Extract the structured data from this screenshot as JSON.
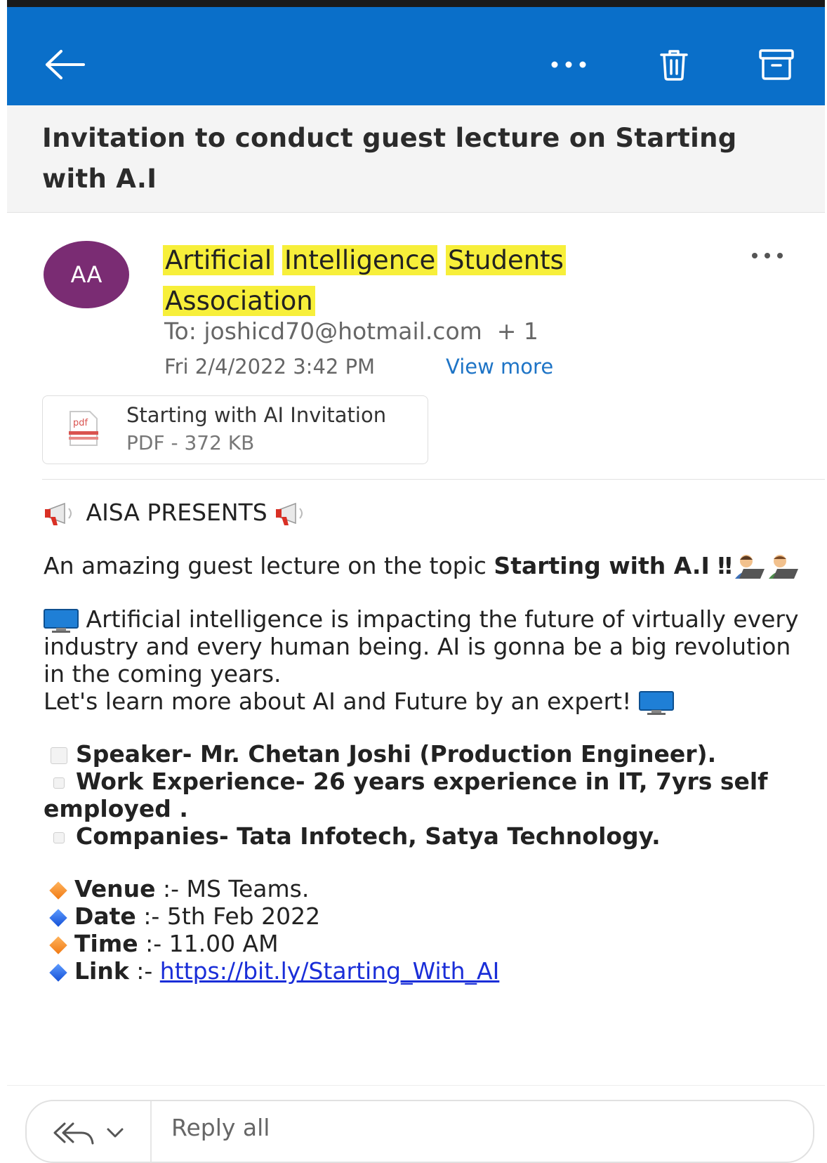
{
  "toolbar": {
    "back_icon": "arrow-left-icon",
    "more_icon": "more-horizontal-icon",
    "delete_icon": "trash-icon",
    "archive_icon": "archive-icon",
    "bar_color": "#0a6fc9"
  },
  "email": {
    "subject": "Invitation to conduct guest lecture on Starting with A.I",
    "avatar_initials": "AA",
    "avatar_color": "#7a2c73",
    "sender_words": [
      "Artificial",
      "Intelligence",
      "Students",
      "Association"
    ],
    "to": "To: joshicd70@hotmail.com",
    "to_extra": "+ 1",
    "date": "Fri 2/4/2022 3:42 PM",
    "view_more": "View more",
    "highlight_color": "#f7ef3a"
  },
  "attachment": {
    "icon": "pdf-icon",
    "name": "Starting with AI Invitation",
    "meta": "PDF - 372 KB"
  },
  "body": {
    "presents": "AISA PRESENTS",
    "intro": "An amazing guest lecture on the topic ",
    "intro_bold": "Starting with A.I",
    "intro_tail": " ‼",
    "para_1": "Artificial intelligence is impacting the future of virtually every industry and every human being. AI is gonna be a big revolution in the coming years.",
    "para_2": "Let's learn more about AI and Future by an expert!",
    "bullets": [
      "Speaker- Mr. Chetan Joshi (Production Engineer).",
      "Work Experience- 26 years experience in IT, 7yrs self employed .",
      "Companies- Tata Infotech, Satya Technology."
    ],
    "details": [
      {
        "label": "Venue",
        "value": " :- MS Teams."
      },
      {
        "label": "Date",
        "value": " :- 5th Feb 2022"
      },
      {
        "label": "Time",
        "value": " :- 11.00 AM"
      },
      {
        "label": "Link",
        "value": " :- "
      }
    ],
    "link_text": "https://bit.ly/Starting_With_AI"
  },
  "reply_bar": {
    "icon": "reply-all-icon",
    "dropdown_icon": "chevron-down-icon",
    "label": "Reply all"
  }
}
